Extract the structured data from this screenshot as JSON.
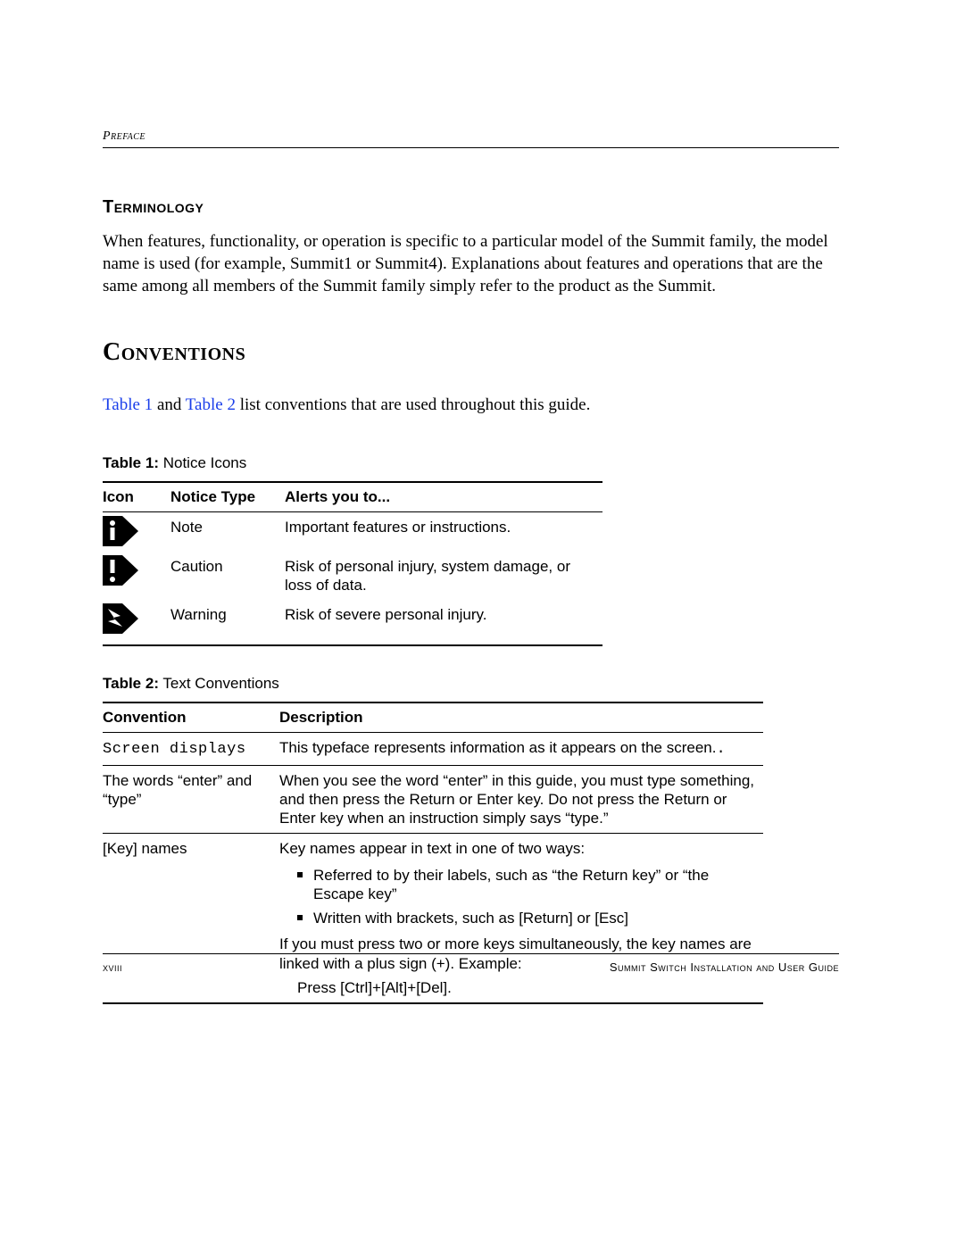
{
  "runningHead": "Preface",
  "terminology": {
    "heading": "Terminology",
    "body": "When features, functionality, or operation is specific to a particular model of the Summit family, the model name is used (for example, Summit1 or Summit4). Explanations about features and operations that are the same among all members of the Summit family simply refer to the product as the Summit."
  },
  "conventions": {
    "heading": "Conventions",
    "introPre": "",
    "link1": "Table 1",
    "mid": " and ",
    "link2": "Table 2",
    "introPost": " list conventions that are used throughout this guide."
  },
  "table1": {
    "captionLabel": "Table 1:",
    "captionText": "  Notice Icons",
    "headers": {
      "c1": "Icon",
      "c2": "Notice Type",
      "c3": "Alerts you to..."
    },
    "rows": [
      {
        "icon": "info-icon",
        "type": "Note",
        "alert": "Important features or instructions."
      },
      {
        "icon": "caution-icon",
        "type": "Caution",
        "alert": "Risk of personal injury, system damage, or loss of data."
      },
      {
        "icon": "warning-icon",
        "type": "Warning",
        "alert": "Risk of severe personal injury."
      }
    ]
  },
  "table2": {
    "captionLabel": "Table 2:",
    "captionText": "  Text Conventions",
    "headers": {
      "c1": "Convention",
      "c2": "Description"
    },
    "rows": {
      "r0": {
        "conv": "Screen displays",
        "desc": "This typeface represents information as it appears on the screen."
      },
      "r1": {
        "conv": "The words “enter” and “type”",
        "desc": "When you see the word “enter” in this guide, you must type something, and then press the Return or Enter key. Do not press the Return or Enter key when an instruction simply says “type.”"
      },
      "r2": {
        "conv": "[Key] names",
        "lead": "Key names appear in text in one of two ways:",
        "b1": "Referred to by their labels, such as “the Return key” or “the Escape key”",
        "b2": "Written with brackets, such as [Return] or [Esc]",
        "tail": "If you must press two or more keys simultaneously, the key names are linked with a plus sign (+). Example:",
        "example": "Press [Ctrl]+[Alt]+[Del]."
      }
    }
  },
  "footer": {
    "left": "xviii",
    "right": "Summit Switch Installation and User Guide"
  }
}
